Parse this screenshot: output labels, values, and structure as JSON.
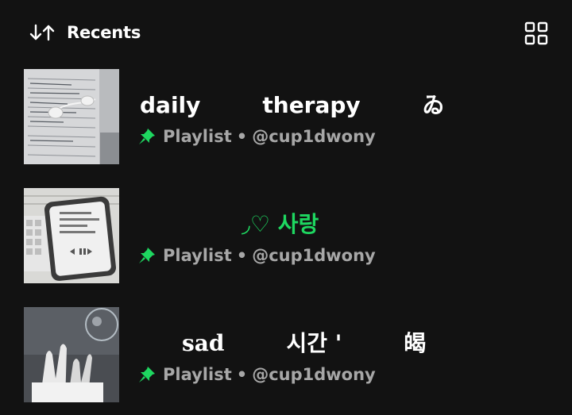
{
  "header": {
    "title": "Recents"
  },
  "accent_color": "#1ed760",
  "playlists": [
    {
      "title": "daily        therapy        ゐ",
      "title_color": "#ffffff",
      "type": "Playlist",
      "separator": "•",
      "owner": "@cup1dwony",
      "pinned": true
    },
    {
      "title": "◞♡ 사랑",
      "title_color": "#1ed760",
      "type": "Playlist",
      "separator": "•",
      "owner": "@cup1dwony",
      "pinned": true
    },
    {
      "title": "sad        시간 '        㿣",
      "title_color": "#ffffff",
      "type": "Playlist",
      "separator": "•",
      "owner": "@cup1dwony",
      "pinned": true
    }
  ]
}
